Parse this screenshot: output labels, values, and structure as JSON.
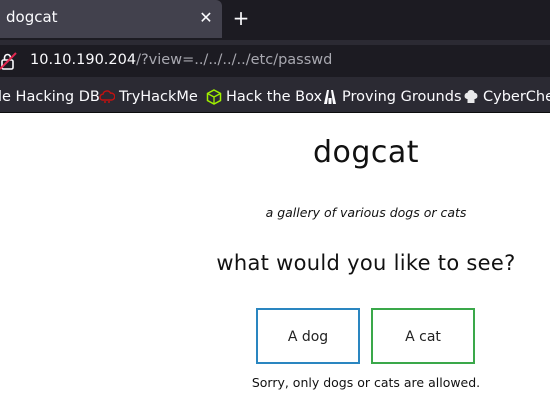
{
  "browser": {
    "tab": {
      "title": "dogcat",
      "close_glyph": "✕"
    },
    "new_tab_glyph": "+",
    "url": {
      "host": "10.10.190.204",
      "path": "/?view=../../../../etc/passwd"
    },
    "bookmarks": [
      {
        "label": "le Hacking DB",
        "icon": "exploit-db-icon"
      },
      {
        "label": "TryHackMe",
        "icon": "tryhackme-icon"
      },
      {
        "label": "Hack the Box",
        "icon": "hackthebox-icon"
      },
      {
        "label": "Proving Grounds",
        "icon": "proving-grounds-icon"
      },
      {
        "label": "CyberChef",
        "icon": "cyberchef-icon"
      }
    ]
  },
  "page": {
    "title": "dogcat",
    "subtitle": "a gallery of various dogs or cats",
    "question": "what would you like to see?",
    "buttons": {
      "dog": "A dog",
      "cat": "A cat"
    },
    "warning": "Sorry, only dogs or cats are allowed."
  },
  "colors": {
    "dog_border": "#2a86c0",
    "cat_border": "#3aa84a",
    "lock_icon": "#e22850",
    "tryhackme_icon": "#c11111",
    "hackthebox_icon": "#9fef00"
  }
}
